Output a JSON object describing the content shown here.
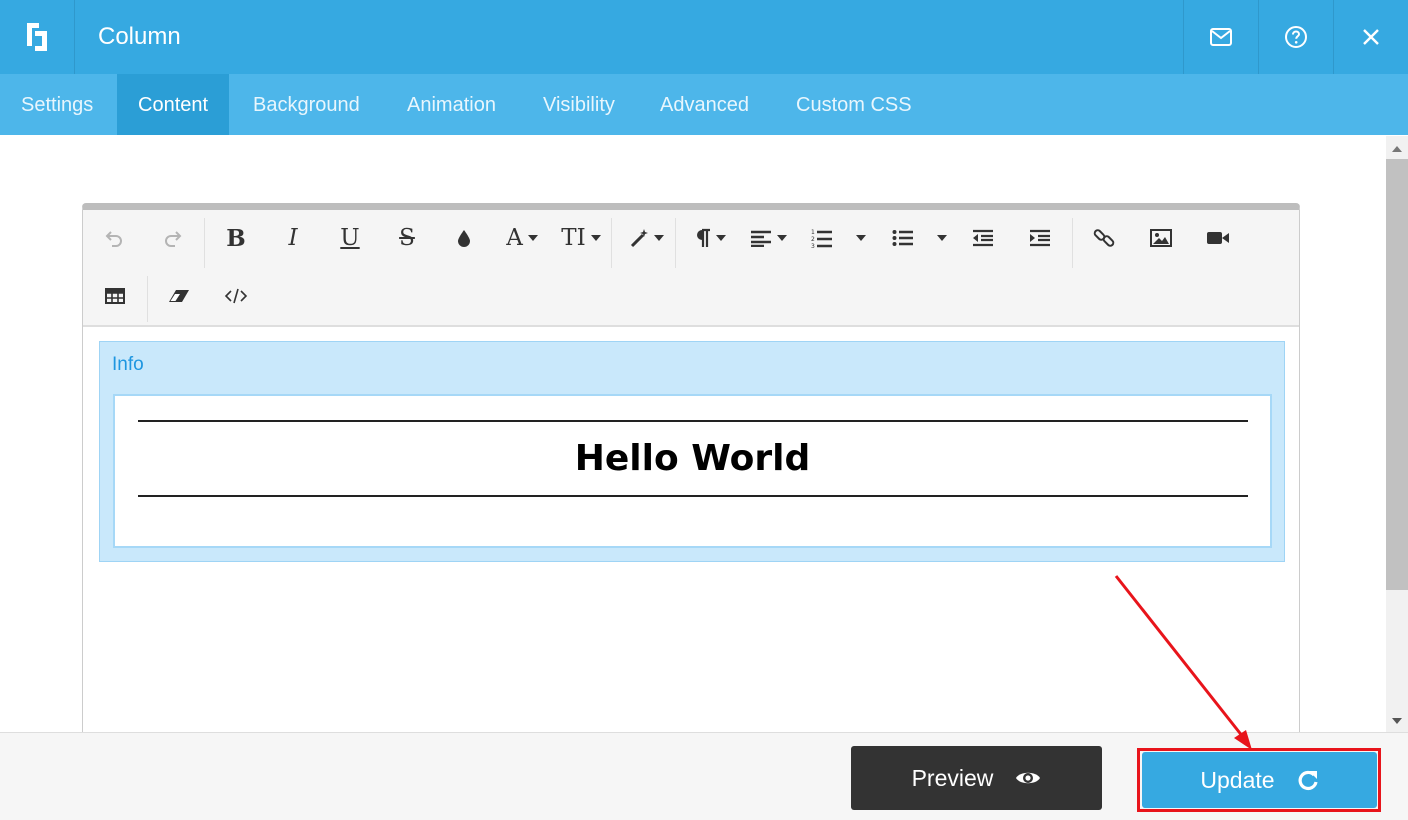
{
  "header": {
    "title": "Column",
    "logo_icon": "builder-logo-icon",
    "buttons": [
      "envelope-icon",
      "help-icon",
      "close-icon"
    ],
    "color": "#36a9e1"
  },
  "tabs": [
    {
      "label": "Settings",
      "active": false
    },
    {
      "label": "Content",
      "active": true
    },
    {
      "label": "Background",
      "active": false
    },
    {
      "label": "Animation",
      "active": false
    },
    {
      "label": "Visibility",
      "active": false
    },
    {
      "label": "Advanced",
      "active": false
    },
    {
      "label": "Custom CSS",
      "active": false
    }
  ],
  "toolbar": {
    "tools": [
      "undo",
      "redo",
      "bold",
      "italic",
      "underline",
      "strikethrough",
      "color",
      "font-family",
      "font-size",
      "style",
      "paragraph",
      "align",
      "ordered-list",
      "unordered-list",
      "outdent",
      "indent",
      "link",
      "image",
      "video",
      "table",
      "clear-format",
      "code-view"
    ],
    "labels": {
      "bold": "B",
      "italic": "I",
      "underline": "U",
      "strike": "S",
      "font": "A",
      "size": "TI"
    }
  },
  "content": {
    "info_label": "Info",
    "heading": "Hello World"
  },
  "footer": {
    "preview_label": "Preview",
    "update_label": "Update",
    "highlight_color": "#e8141b"
  }
}
